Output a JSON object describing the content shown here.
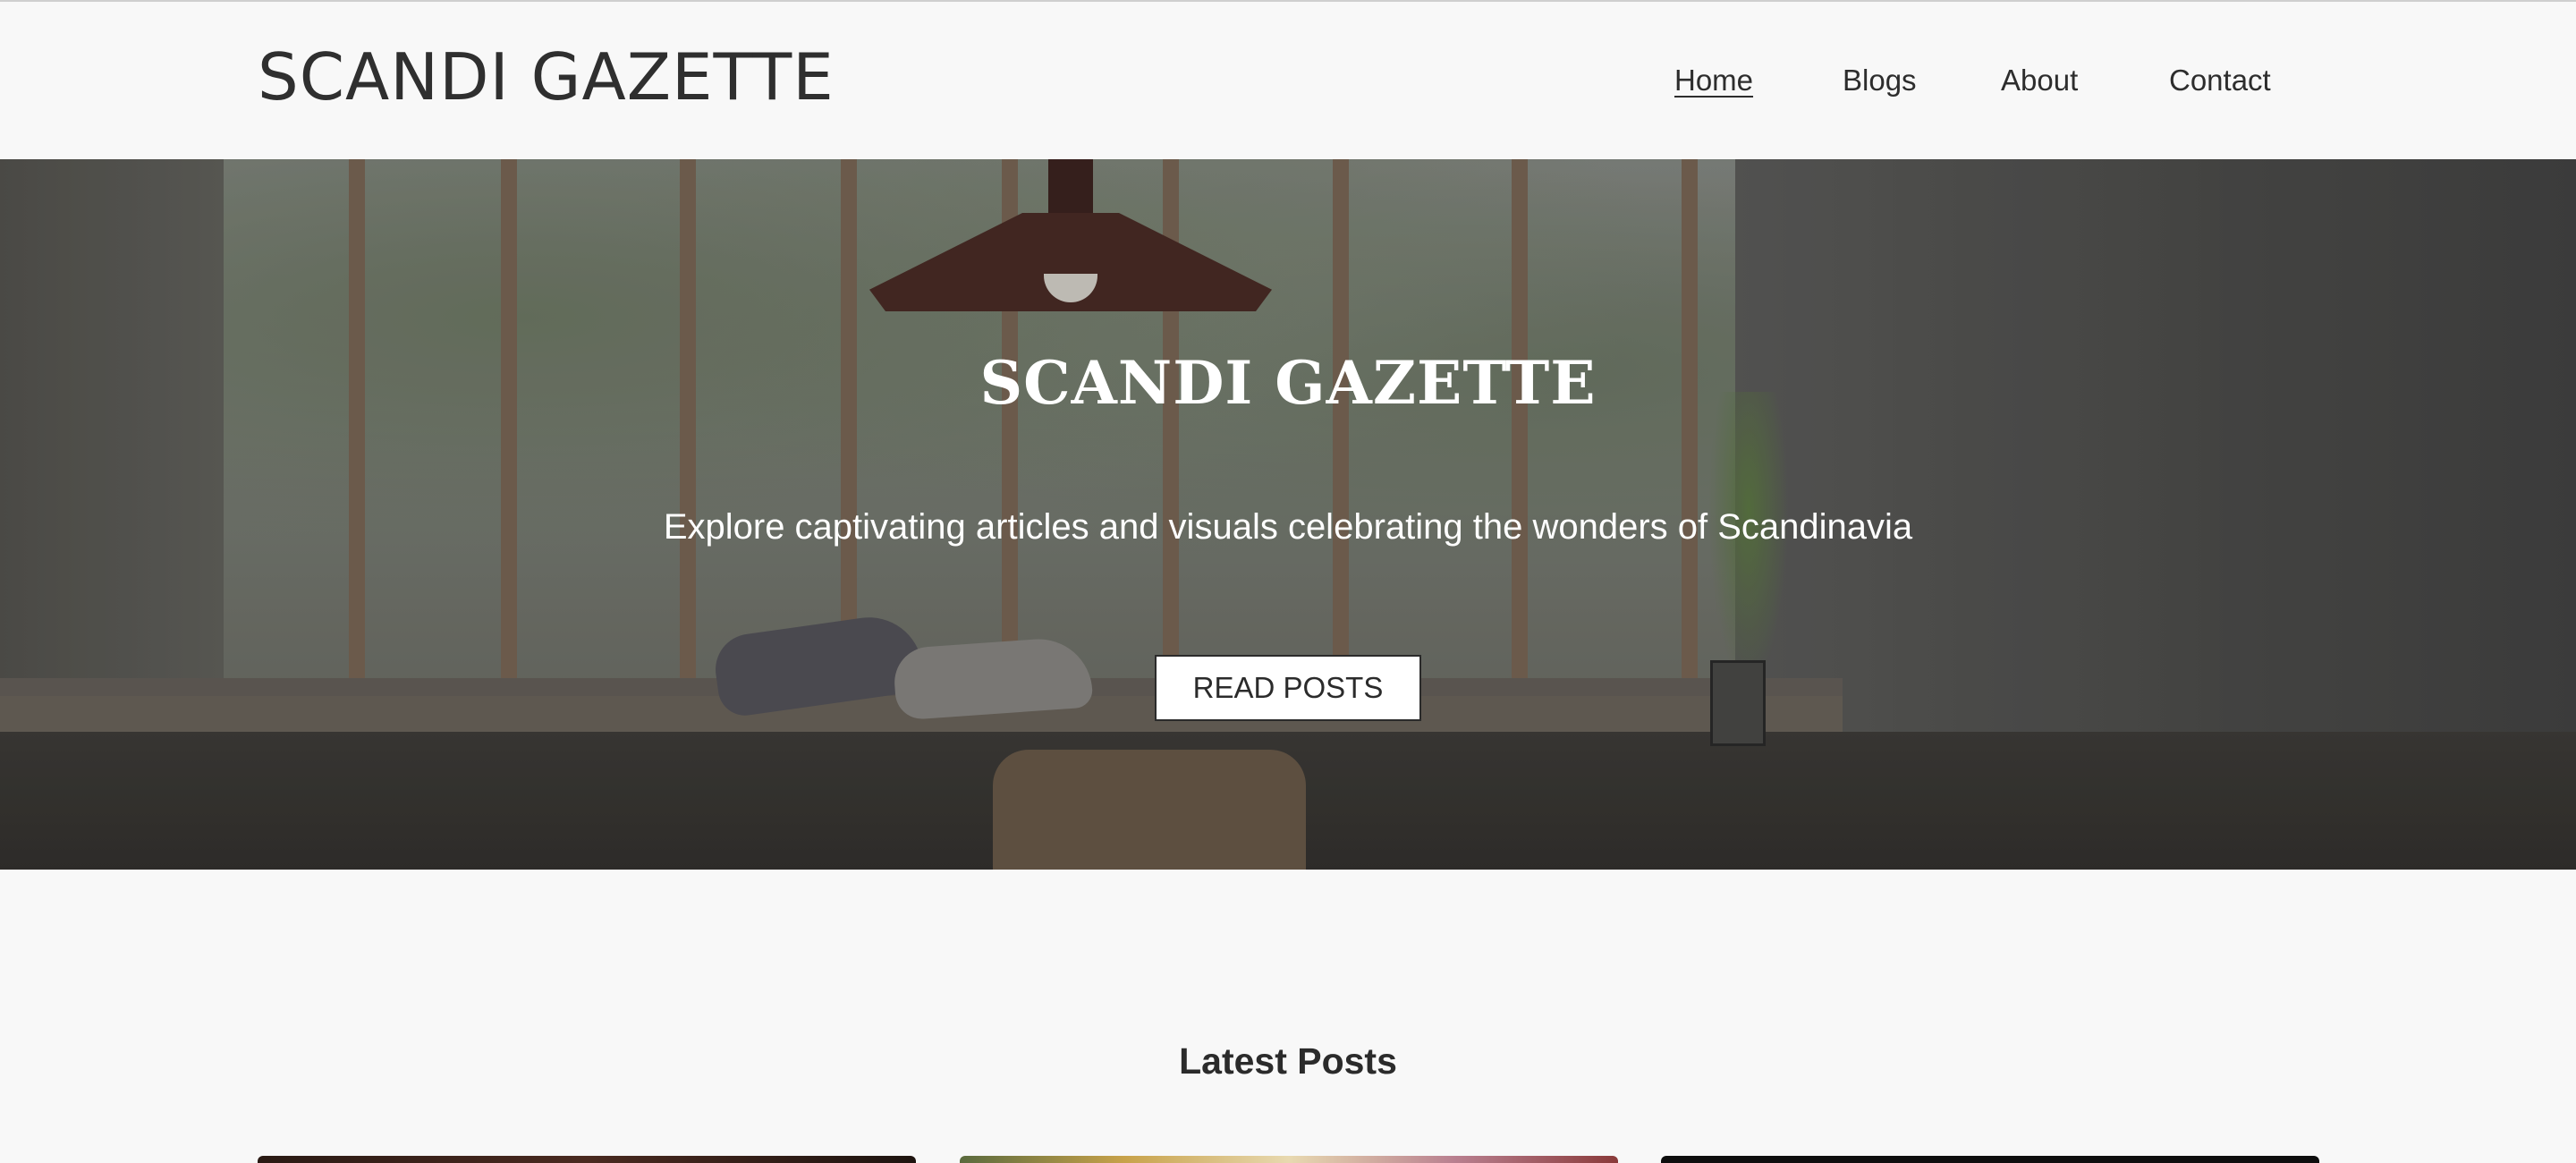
{
  "site": {
    "logo": "SCANDI GAZETTE"
  },
  "nav": {
    "items": [
      {
        "label": "Home",
        "active": true
      },
      {
        "label": "Blogs",
        "active": false
      },
      {
        "label": "About",
        "active": false
      },
      {
        "label": "Contact",
        "active": false
      }
    ]
  },
  "hero": {
    "title": "SCANDI GAZETTE",
    "subtitle": "Explore captivating articles and visuals celebrating the wonders of Scandinavia",
    "button_label": "READ POSTS"
  },
  "latest": {
    "title": "Latest Posts"
  },
  "colors": {
    "background": "#f8f8f8",
    "text": "#2b2b2b",
    "hero_text": "#ffffff",
    "button_bg": "#ffffff"
  }
}
